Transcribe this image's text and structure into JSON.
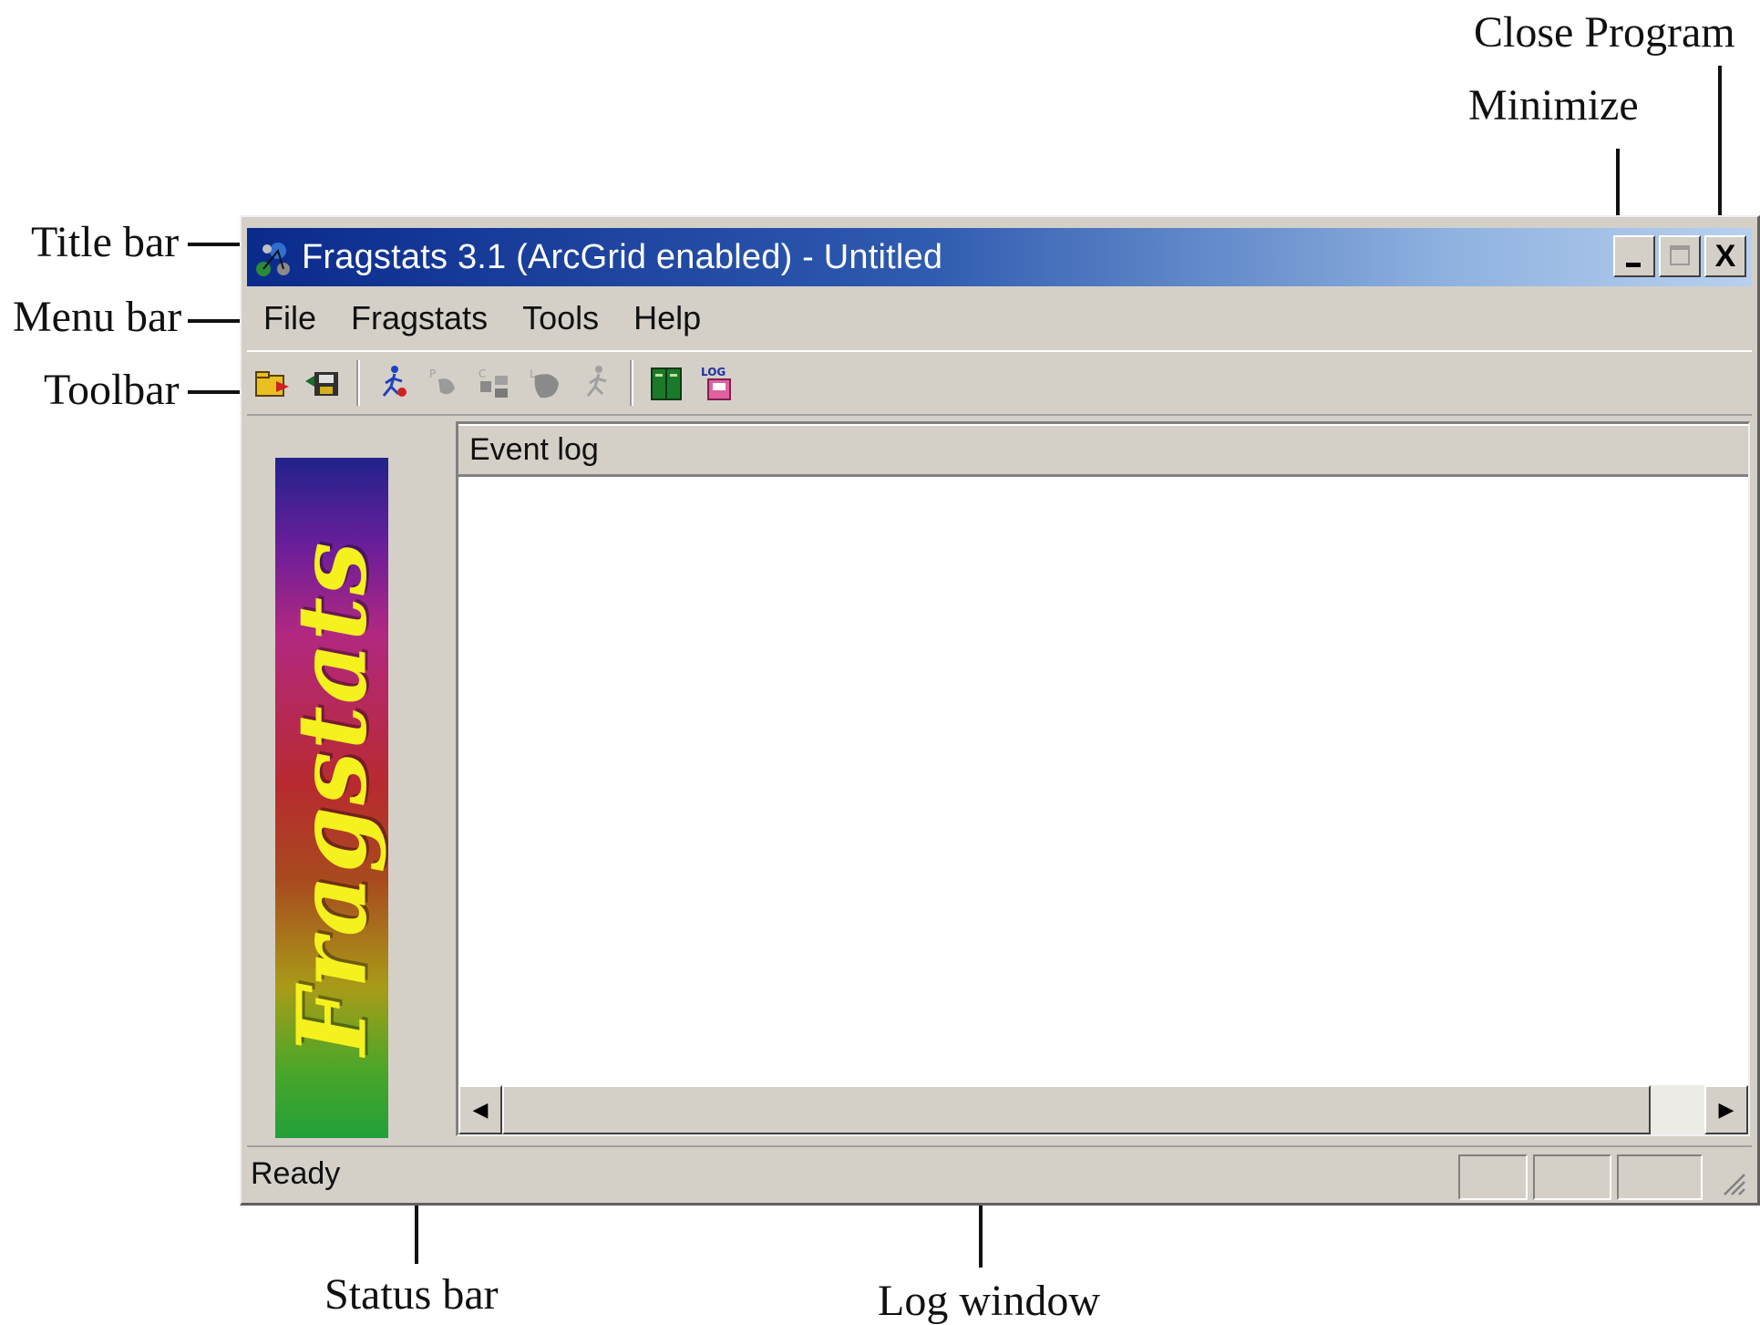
{
  "annotations": {
    "close_program": "Close Program",
    "minimize": "Minimize",
    "title_bar": "Title bar",
    "menu_bar": "Menu bar",
    "toolbar": "Toolbar",
    "status_bar": "Status bar",
    "log_window": "Log window"
  },
  "window": {
    "title": "Fragstats 3.1 (ArcGrid enabled) - Untitled",
    "caption_buttons": {
      "minimize": "_",
      "maximize": "□",
      "close": "X"
    }
  },
  "menu": [
    "File",
    "Fragstats",
    "Tools",
    "Help"
  ],
  "toolbar_icons": [
    "open-model-icon",
    "save-model-icon",
    "run-icon",
    "results-patch-icon",
    "results-class-icon",
    "results-landscape-icon",
    "batch-run-icon",
    "help-book-icon",
    "log-icon"
  ],
  "logo": {
    "text": "Fragstats"
  },
  "log_pane": {
    "header": "Event log"
  },
  "status": {
    "text": "Ready"
  },
  "colors": {
    "title_bar_start": "#0a2a8c",
    "title_bar_end": "#b8d0ee",
    "chrome": "#d4d0c8",
    "logo_text": "#f4f11e"
  }
}
